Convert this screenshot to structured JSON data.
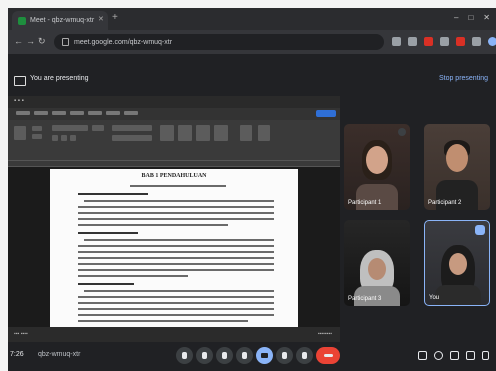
{
  "browser": {
    "tab_title": "Meet - qbz-wmuq-xtr",
    "url": "meet.google.com/qbz-wmuq-xtr"
  },
  "meet": {
    "presenting_text": "You are presenting",
    "stop_presenting": "Stop presenting",
    "clock": "7:26",
    "meeting_code": "qbz-wmuq-xtr",
    "accent_color": "#8ab4f8",
    "hangup_color": "#ea4335"
  },
  "document": {
    "heading": "BAB 1 PENDAHULUAN",
    "section_a": "A. Latar Belakang",
    "section_b": "B. Rumusan Masalah",
    "section_c": "C. Tujuan Penulisan"
  },
  "participants": [
    {
      "name": "Participant 1"
    },
    {
      "name": "Participant 2"
    },
    {
      "name": "Participant 3"
    },
    {
      "name": "You"
    }
  ],
  "icons": [
    "tab-favicon-icon",
    "close-icon",
    "new-tab-icon",
    "back-icon",
    "forward-icon",
    "reload-icon",
    "lock-icon",
    "present-screen-icon",
    "mic-icon",
    "camera-icon",
    "captions-icon",
    "emoji-icon",
    "present-icon",
    "raise-hand-icon",
    "more-icon",
    "hangup-icon",
    "info-icon",
    "people-icon",
    "chat-icon",
    "activities-icon"
  ]
}
